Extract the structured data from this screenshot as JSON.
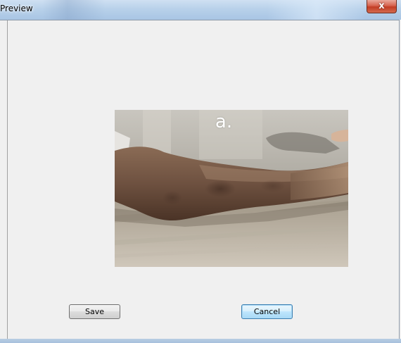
{
  "window": {
    "title": "Preview"
  },
  "titlebar": {
    "close_label": "x"
  },
  "preview": {
    "image_label": "a.",
    "image_subject": "forearm-photo"
  },
  "buttons": {
    "save_label": "Save",
    "cancel_label": "Cancel"
  },
  "colors": {
    "window_bg": "#f0f0f0",
    "titlebar": "#b8d1ea",
    "close_button": "#c23d24",
    "default_button_border": "#3c7fb1"
  }
}
